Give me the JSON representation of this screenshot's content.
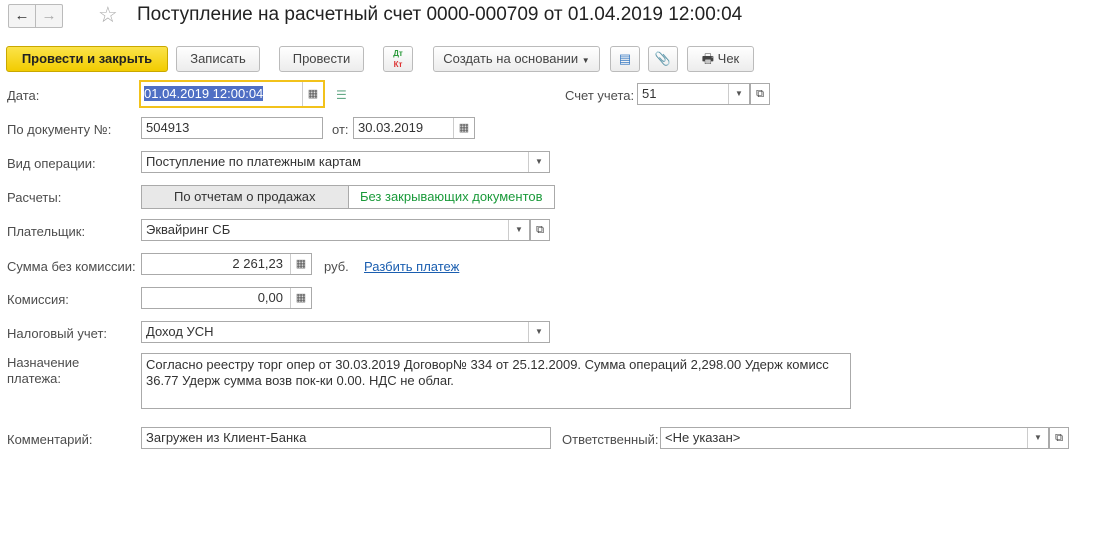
{
  "header": {
    "back": "←",
    "forward": "→",
    "star": "☆",
    "title": "Поступление на расчетный счет 0000-000709 от 01.04.2019 12:00:04"
  },
  "toolbar": {
    "post_close": "Провести и закрыть",
    "save": "Записать",
    "post": "Провести",
    "dtkt_dt": "Дт",
    "dtkt_kt": "Кт",
    "create_based": "Создать на основании",
    "check": "Чек"
  },
  "form": {
    "date_label": "Дата:",
    "date": "01.04.2019 12:00:04",
    "account_label": "Счет учета:",
    "account": "51",
    "docnum_label": "По документу №:",
    "docnum": "504913",
    "from_label": "от:",
    "docdate": "30.03.2019",
    "optype_label": "Вид операции:",
    "optype": "Поступление по платежным картам",
    "settle_label": "Расчеты:",
    "settle_opt1": "По отчетам о продажах",
    "settle_opt2": "Без закрывающих документов",
    "payer_label": "Плательщик:",
    "payer": "Эквайринг СБ",
    "sum_label": "Сумма без комиссии:",
    "sum": "2 261,23",
    "currency": "руб.",
    "split_link": "Разбить платеж",
    "fee_label": "Комиссия:",
    "fee": "0,00",
    "tax_label": "Налоговый учет:",
    "tax": "Доход УСН",
    "purpose_label": "Назначение платежа:",
    "purpose": "Согласно реестру торг опер от 30.03.2019 Договор№ 334 от 25.12.2009. Сумма операций 2,298.00 Удерж комисс 36.77 Удерж сумма возв пок-ки 0.00. НДС не облаг.",
    "comment_label": "Комментарий:",
    "comment": "Загружен из Клиент-Банка",
    "resp_label": "Ответственный:",
    "resp": "<Не указан>"
  }
}
